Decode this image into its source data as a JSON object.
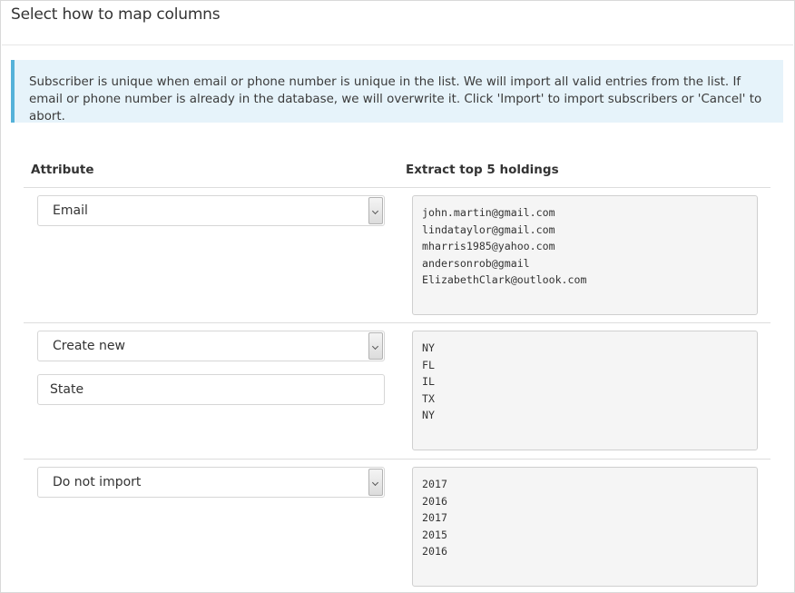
{
  "header": {
    "title": "Select how to map columns"
  },
  "notice": {
    "text": "Subscriber is unique when email or phone number is unique in the list. We will import all valid entries from the list. If email or phone number is already in the database, we will overwrite it. Click 'Import' to import subscribers or 'Cancel' to abort."
  },
  "columns": {
    "attribute": "Attribute",
    "extract": "Extract top 5 holdings"
  },
  "rows": [
    {
      "select": "Email",
      "samples": [
        "john.martin@gmail.com",
        "lindataylor@gmail.com",
        "mharris1985@yahoo.com",
        "andersonrob@gmail",
        "ElizabethClark@outlook.com"
      ]
    },
    {
      "select": "Create new",
      "input": "State",
      "samples": [
        "NY",
        "FL",
        "IL",
        "TX",
        "NY"
      ]
    },
    {
      "select": "Do not import",
      "samples": [
        "2017",
        "2016",
        "2017",
        "2015",
        "2016"
      ]
    }
  ],
  "icons": {
    "dropdown": "chevron-down-icon"
  },
  "colors": {
    "notice_bg": "#e6f3fa",
    "notice_accent": "#55b2d9",
    "sample_bg": "#f5f5f5"
  }
}
